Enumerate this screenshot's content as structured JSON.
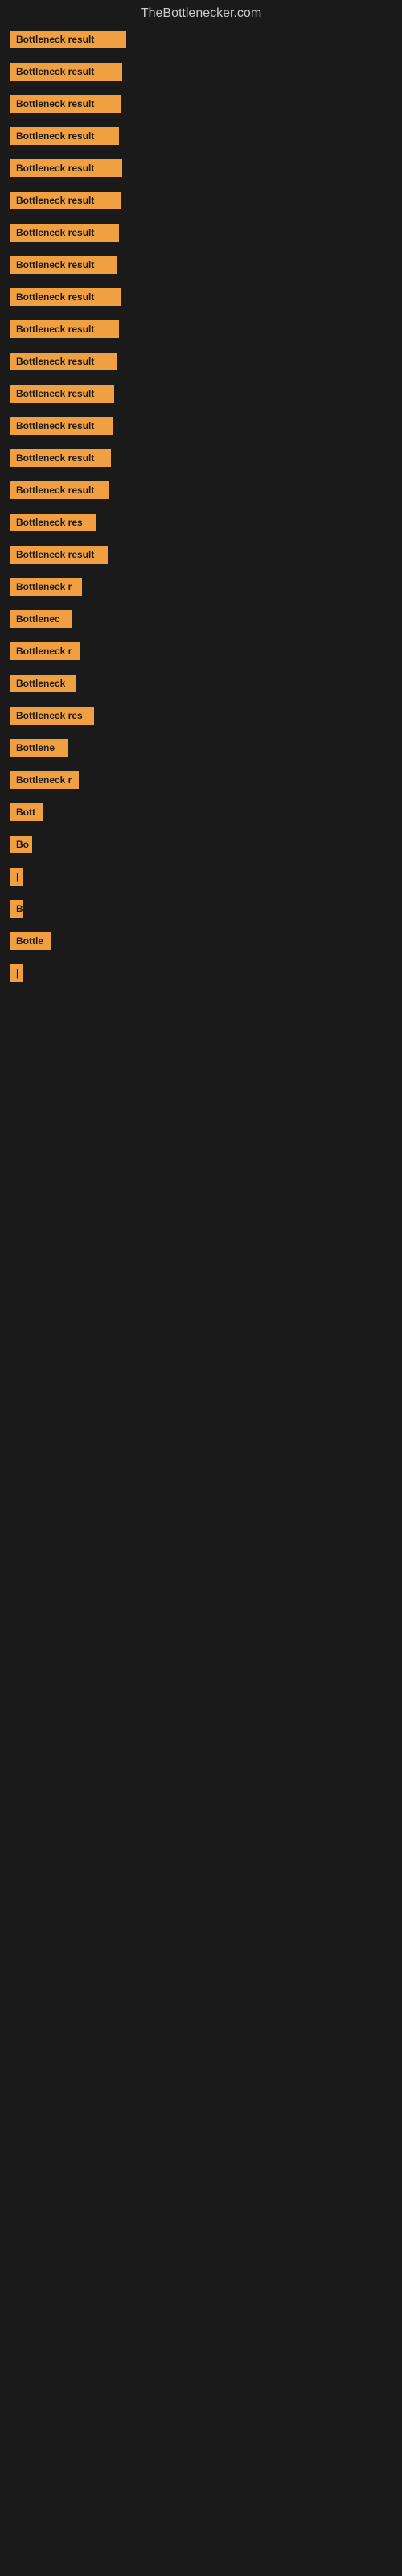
{
  "site_title": "TheBottlenecker.com",
  "items": [
    {
      "id": 1,
      "label": "Bottleneck result",
      "width": 145
    },
    {
      "id": 2,
      "label": "Bottleneck result",
      "width": 140
    },
    {
      "id": 3,
      "label": "Bottleneck result",
      "width": 138
    },
    {
      "id": 4,
      "label": "Bottleneck result",
      "width": 136
    },
    {
      "id": 5,
      "label": "Bottleneck result",
      "width": 140
    },
    {
      "id": 6,
      "label": "Bottleneck result",
      "width": 138
    },
    {
      "id": 7,
      "label": "Bottleneck result",
      "width": 136
    },
    {
      "id": 8,
      "label": "Bottleneck result",
      "width": 134
    },
    {
      "id": 9,
      "label": "Bottleneck result",
      "width": 138
    },
    {
      "id": 10,
      "label": "Bottleneck result",
      "width": 136
    },
    {
      "id": 11,
      "label": "Bottleneck result",
      "width": 134
    },
    {
      "id": 12,
      "label": "Bottleneck result",
      "width": 130
    },
    {
      "id": 13,
      "label": "Bottleneck result",
      "width": 128
    },
    {
      "id": 14,
      "label": "Bottleneck result",
      "width": 126
    },
    {
      "id": 15,
      "label": "Bottleneck result",
      "width": 124
    },
    {
      "id": 16,
      "label": "Bottleneck res",
      "width": 108
    },
    {
      "id": 17,
      "label": "Bottleneck result",
      "width": 122
    },
    {
      "id": 18,
      "label": "Bottleneck r",
      "width": 90
    },
    {
      "id": 19,
      "label": "Bottlenec",
      "width": 78
    },
    {
      "id": 20,
      "label": "Bottleneck r",
      "width": 88
    },
    {
      "id": 21,
      "label": "Bottleneck",
      "width": 82
    },
    {
      "id": 22,
      "label": "Bottleneck res",
      "width": 105
    },
    {
      "id": 23,
      "label": "Bottlene",
      "width": 72
    },
    {
      "id": 24,
      "label": "Bottleneck r",
      "width": 86
    },
    {
      "id": 25,
      "label": "Bott",
      "width": 42
    },
    {
      "id": 26,
      "label": "Bo",
      "width": 28
    },
    {
      "id": 27,
      "label": "|",
      "width": 10
    },
    {
      "id": 28,
      "label": "B",
      "width": 16
    },
    {
      "id": 29,
      "label": "Bottle",
      "width": 52
    },
    {
      "id": 30,
      "label": "|",
      "width": 8
    }
  ],
  "colors": {
    "badge_bg": "#f0a040",
    "site_title": "#cccccc",
    "body_bg": "#1a1a1a"
  }
}
